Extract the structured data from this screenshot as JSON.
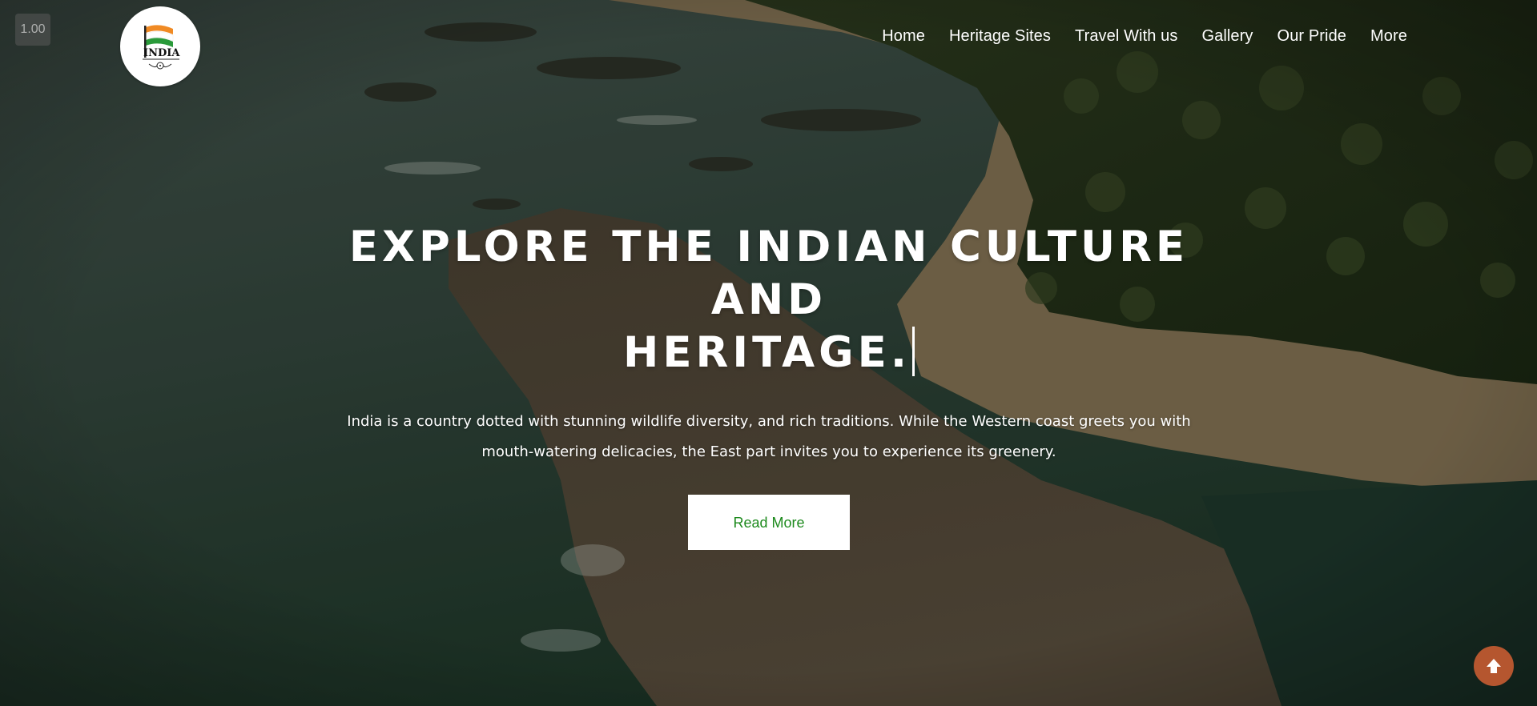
{
  "zoom_badge": "1.00",
  "logo": {
    "text": "INDIA",
    "icon": "india-flag-logo-icon"
  },
  "nav": {
    "items": [
      {
        "label": "Home"
      },
      {
        "label": "Heritage Sites"
      },
      {
        "label": "Travel With us"
      },
      {
        "label": "Gallery"
      },
      {
        "label": "Our Pride"
      },
      {
        "label": "More"
      }
    ]
  },
  "hero": {
    "title_line1": "EXPLORE THE INDIAN CULTURE AND",
    "title_line2": "HERITAGE.",
    "description": "India is a country dotted with stunning wildlife diversity, and rich traditions. While the Western coast greets you with mouth-watering delicacies, the East part invites you to experience its greenery.",
    "button_label": "Read More"
  },
  "scroll_top": {
    "icon": "arrow-up-icon"
  },
  "colors": {
    "button_text": "#1d8a1d",
    "scroll_top_bg": "#b5562f",
    "nav_text": "#ffffff"
  }
}
